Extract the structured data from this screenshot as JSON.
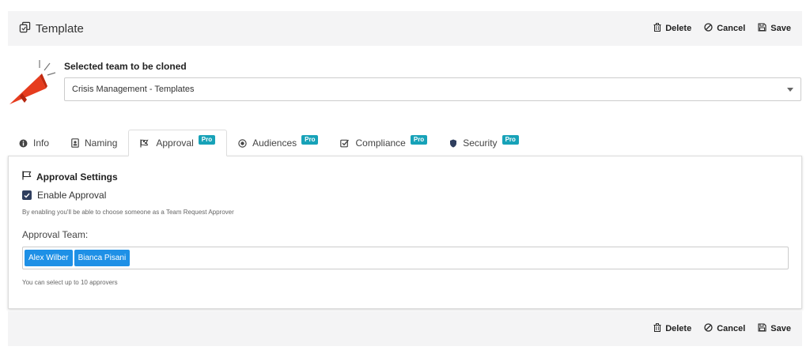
{
  "header": {
    "title": "Template"
  },
  "actions": {
    "delete": "Delete",
    "cancel": "Cancel",
    "save": "Save"
  },
  "clone": {
    "label": "Selected team to be cloned",
    "selected": "Crisis Management - Templates"
  },
  "tabs": [
    {
      "label": "Info",
      "pro": "",
      "icon": "info-circle-icon"
    },
    {
      "label": "Naming",
      "pro": "",
      "icon": "id-badge-icon"
    },
    {
      "label": "Approval",
      "pro": "Pro",
      "icon": "flag-checkered-icon"
    },
    {
      "label": "Audiences",
      "pro": "Pro",
      "icon": "dot-circle-icon"
    },
    {
      "label": "Compliance",
      "pro": "Pro",
      "icon": "check-square-icon"
    },
    {
      "label": "Security",
      "pro": "Pro",
      "icon": "shield-icon"
    }
  ],
  "active_tab": "Approval",
  "approval": {
    "section_title": "Approval Settings",
    "enable_label": "Enable Approval",
    "enable_checked": true,
    "enable_hint": "By enabling you'll be able to choose someone as a Team Request Approver",
    "team_label": "Approval Team:",
    "approvers": [
      "Alex Wilber",
      "Bianca Pisani"
    ],
    "limit_hint": "You can select up to 10 approvers"
  },
  "colors": {
    "accent": "#1e90e6",
    "pro_badge": "#17a2b8",
    "checkbox": "#2f3e5e",
    "megaphone": "#e63c1e"
  }
}
